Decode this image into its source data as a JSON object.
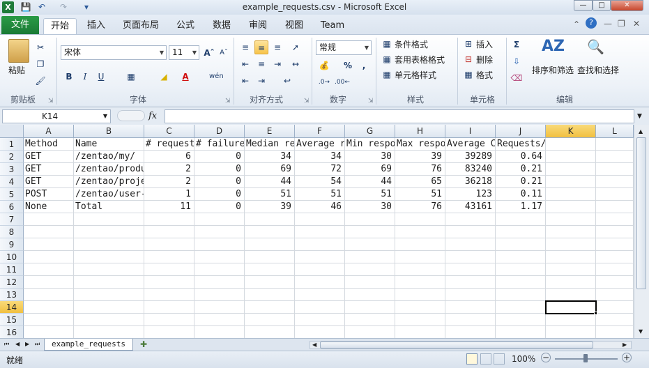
{
  "window": {
    "title": "example_requests.csv  -  Microsoft Excel",
    "app_icon": "X",
    "controls": [
      "minimize",
      "maximize",
      "close"
    ]
  },
  "tabs": [
    "文件",
    "开始",
    "插入",
    "页面布局",
    "公式",
    "数据",
    "审阅",
    "视图",
    "Team"
  ],
  "active_tab": "开始",
  "ribbon": {
    "clipboard": {
      "label": "剪贴板",
      "paste": "粘贴"
    },
    "font": {
      "label": "字体",
      "name": "宋体",
      "size": "11",
      "bold": "B",
      "italic": "I",
      "underline": "U"
    },
    "alignment": {
      "label": "对齐方式"
    },
    "number": {
      "label": "数字",
      "format": "常规",
      "percent": "%",
      "comma": ","
    },
    "styles": {
      "label": "样式",
      "conditional": "条件格式",
      "table": "套用表格格式",
      "cell": "单元格样式"
    },
    "cells": {
      "label": "单元格",
      "insert": "插入",
      "delete": "删除",
      "format": "格式"
    },
    "editing": {
      "label": "编辑",
      "sort": "排序和筛选",
      "find": "查找和选择"
    }
  },
  "formula_bar": {
    "name_box": "K14",
    "fx": "fx",
    "formula": ""
  },
  "columns": [
    "A",
    "B",
    "C",
    "D",
    "E",
    "F",
    "G",
    "H",
    "I",
    "J",
    "K",
    "L"
  ],
  "selected_column": "K",
  "rows": [
    "1",
    "2",
    "3",
    "4",
    "5",
    "6",
    "7",
    "8",
    "9",
    "10",
    "11",
    "12",
    "13",
    "14",
    "15",
    "16"
  ],
  "selected_row": "14",
  "table": [
    [
      "Method",
      "Name",
      "# request",
      "# failure",
      "Median re",
      "Average r",
      "Min respo",
      "Max respo",
      "Average C",
      "Requests/s"
    ],
    [
      "GET",
      "/zentao/my/",
      "6",
      "0",
      "34",
      "34",
      "30",
      "39",
      "39289",
      "0.64"
    ],
    [
      "GET",
      "/zentao/produ",
      "2",
      "0",
      "69",
      "72",
      "69",
      "76",
      "83240",
      "0.21"
    ],
    [
      "GET",
      "/zentao/proje",
      "2",
      "0",
      "44",
      "54",
      "44",
      "65",
      "36218",
      "0.21"
    ],
    [
      "POST",
      "/zentao/user-",
      "1",
      "0",
      "51",
      "51",
      "51",
      "51",
      "123",
      "0.11"
    ],
    [
      "None",
      "Total",
      "11",
      "0",
      "39",
      "46",
      "30",
      "76",
      "43161",
      "1.17"
    ]
  ],
  "sheet_tab": "example_requests",
  "status": "就绪",
  "zoom": "100%"
}
